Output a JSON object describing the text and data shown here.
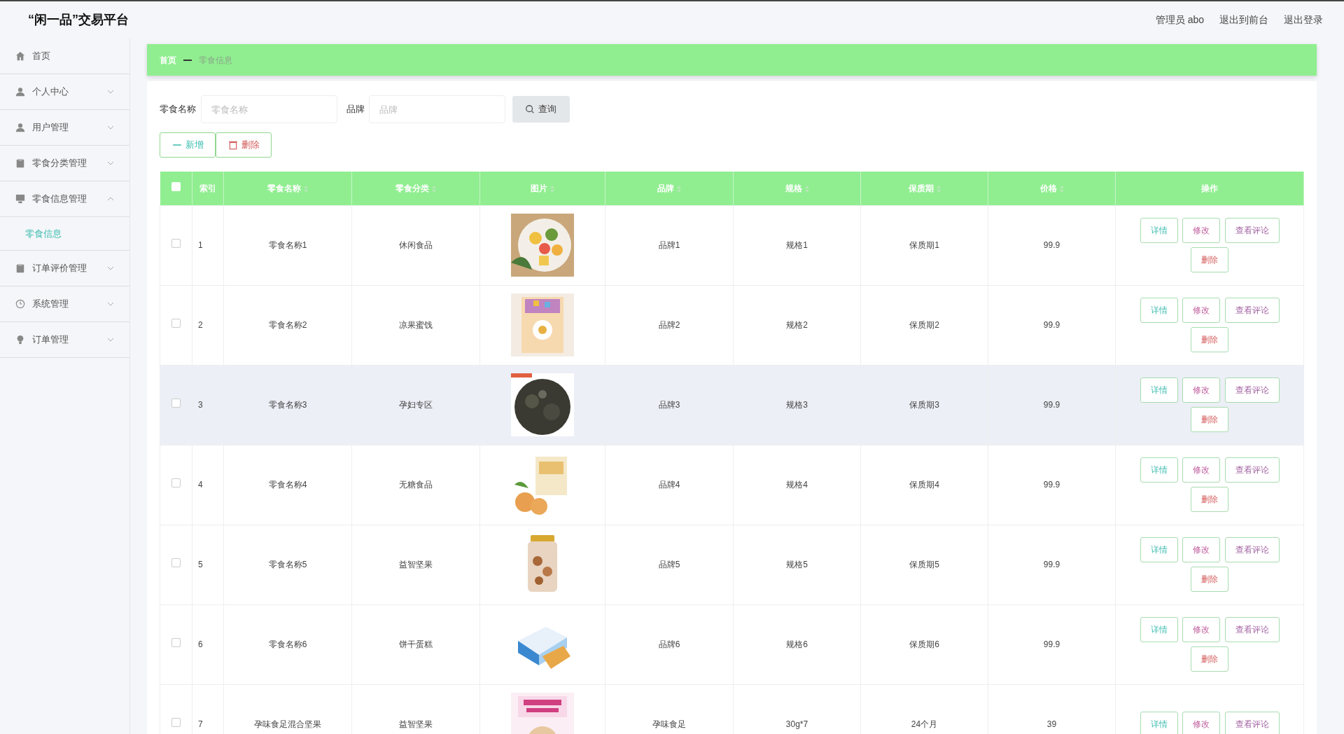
{
  "header": {
    "title": "“闲一品”交易平台",
    "links": [
      {
        "label": "管理员 abo"
      },
      {
        "label": "退出到前台"
      },
      {
        "label": "退出登录"
      }
    ]
  },
  "sidebar": {
    "items": [
      {
        "label": "首页"
      },
      {
        "label": "个人中心",
        "expanded": false
      },
      {
        "label": "用户管理",
        "expanded": false
      },
      {
        "label": "零食分类管理",
        "expanded": false
      },
      {
        "label": "零食信息管理",
        "expanded": true,
        "children": [
          {
            "label": "零食信息",
            "selected": true
          }
        ]
      },
      {
        "label": "订单评价管理",
        "expanded": false
      },
      {
        "label": "系统管理",
        "expanded": false
      },
      {
        "label": "订单管理",
        "expanded": false
      }
    ]
  },
  "breadcrumb": [
    "首页",
    "零食信息"
  ],
  "search": {
    "fields": [
      {
        "label": "零食名称",
        "placeholder": "零食名称"
      },
      {
        "label": "品牌",
        "placeholder": "品牌"
      }
    ],
    "button": "查询"
  },
  "toolbar": [
    {
      "label": "新增",
      "kind": "add"
    },
    {
      "label": "删除",
      "kind": "delete"
    }
  ],
  "table": {
    "select_all": {
      "checked": false
    },
    "columns": [
      {
        "label": "索引",
        "sortable": false
      },
      {
        "label": "零食名称",
        "sortable": true
      },
      {
        "label": "零食分类",
        "sortable": true
      },
      {
        "label": "图片",
        "sortable": true
      },
      {
        "label": "品牌",
        "sortable": true
      },
      {
        "label": "规格",
        "sortable": true
      },
      {
        "label": "保质期",
        "sortable": true
      },
      {
        "label": "价格",
        "sortable": true
      },
      {
        "label": "操作",
        "sortable": false
      }
    ],
    "rows": [
      {
        "checked": false,
        "hovered": false,
        "index": "1",
        "name": "零食名称1",
        "category": "休闲食品",
        "image": {
          "kind": "picture"
        },
        "brand": "品牌1",
        "spec": "规格1",
        "shelf_life": "保质期1",
        "price": "99.9",
        "actions": [
          {
            "label": "详情",
            "kind": "detail"
          },
          {
            "label": "修改",
            "kind": "edit"
          },
          {
            "label": "查看评论",
            "kind": "comments"
          },
          {
            "label": "删除",
            "kind": "delete"
          }
        ]
      },
      {
        "checked": false,
        "hovered": false,
        "index": "2",
        "name": "零食名称2",
        "category": "凉果蜜饯",
        "image": {
          "kind": "picture"
        },
        "brand": "品牌2",
        "spec": "规格2",
        "shelf_life": "保质期2",
        "price": "99.9",
        "actions": [
          {
            "label": "详情",
            "kind": "detail"
          },
          {
            "label": "修改",
            "kind": "edit"
          },
          {
            "label": "查看评论",
            "kind": "comments"
          },
          {
            "label": "删除",
            "kind": "delete"
          }
        ]
      },
      {
        "checked": false,
        "hovered": true,
        "index": "3",
        "name": "零食名称3",
        "category": "孕妇专区",
        "image": {
          "kind": "picture"
        },
        "brand": "品牌3",
        "spec": "规格3",
        "shelf_life": "保质期3",
        "price": "99.9",
        "actions": [
          {
            "label": "详情",
            "kind": "detail"
          },
          {
            "label": "修改",
            "kind": "edit"
          },
          {
            "label": "查看评论",
            "kind": "comments"
          },
          {
            "label": "删除",
            "kind": "delete"
          }
        ]
      },
      {
        "checked": false,
        "hovered": false,
        "index": "4",
        "name": "零食名称4",
        "category": "无糖食品",
        "image": {
          "kind": "picture"
        },
        "brand": "品牌4",
        "spec": "规格4",
        "shelf_life": "保质期4",
        "price": "99.9",
        "actions": [
          {
            "label": "详情",
            "kind": "detail"
          },
          {
            "label": "修改",
            "kind": "edit"
          },
          {
            "label": "查看评论",
            "kind": "comments"
          },
          {
            "label": "删除",
            "kind": "delete"
          }
        ]
      },
      {
        "checked": false,
        "hovered": false,
        "index": "5",
        "name": "零食名称5",
        "category": "益智坚果",
        "image": {
          "kind": "picture"
        },
        "brand": "品牌5",
        "spec": "规格5",
        "shelf_life": "保质期5",
        "price": "99.9",
        "actions": [
          {
            "label": "详情",
            "kind": "detail"
          },
          {
            "label": "修改",
            "kind": "edit"
          },
          {
            "label": "查看评论",
            "kind": "comments"
          },
          {
            "label": "删除",
            "kind": "delete"
          }
        ]
      },
      {
        "checked": false,
        "hovered": false,
        "index": "6",
        "name": "零食名称6",
        "category": "饼干蛋糕",
        "image": {
          "kind": "picture"
        },
        "brand": "品牌6",
        "spec": "规格6",
        "shelf_life": "保质期6",
        "price": "99.9",
        "actions": [
          {
            "label": "详情",
            "kind": "detail"
          },
          {
            "label": "修改",
            "kind": "edit"
          },
          {
            "label": "查看评论",
            "kind": "comments"
          },
          {
            "label": "删除",
            "kind": "delete"
          }
        ]
      },
      {
        "checked": false,
        "hovered": false,
        "index": "7",
        "name": "孕味食足混合坚果",
        "category": "益智坚果",
        "image": {
          "kind": "picture"
        },
        "brand": "孕味食足",
        "spec": "30g*7",
        "shelf_life": "24个月",
        "price": "39",
        "actions": [
          {
            "label": "详情",
            "kind": "detail"
          },
          {
            "label": "修改",
            "kind": "edit"
          },
          {
            "label": "查看评论",
            "kind": "comments"
          }
        ]
      }
    ]
  }
}
